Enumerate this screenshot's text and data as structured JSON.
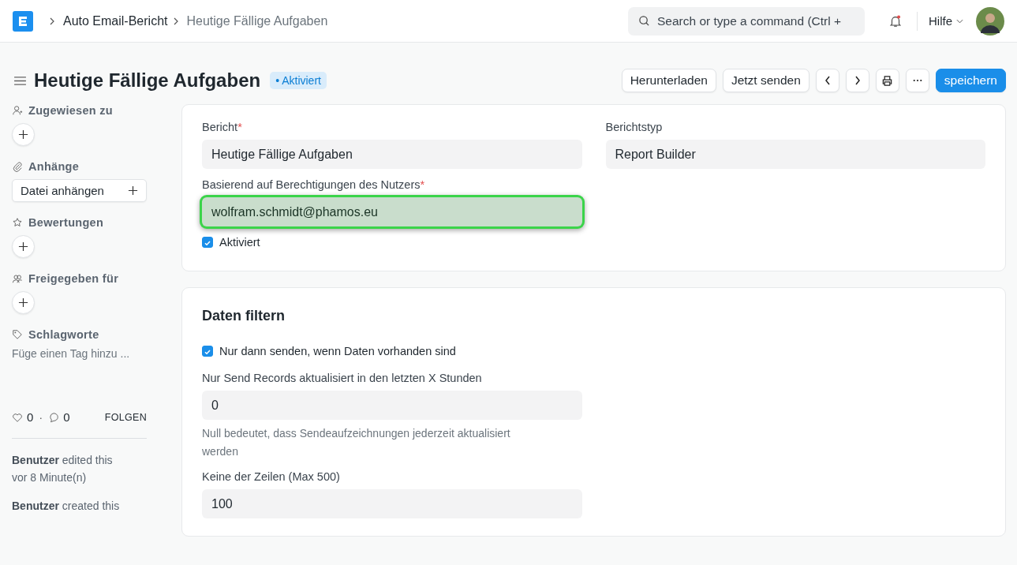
{
  "navbar": {
    "breadcrumbs": [
      {
        "label": "Auto Email-Bericht",
        "current": false
      },
      {
        "label": "Heutige Fällige Aufgaben",
        "current": true
      }
    ],
    "search": {
      "placeholder": "Search or type a command (Ctrl +"
    },
    "notifications": {
      "unread": true
    },
    "help_menu": "Hilfe"
  },
  "page_header": {
    "title": "Heutige Fällige Aufgaben",
    "status": "• Aktiviert",
    "buttons": [
      {
        "kind": "text",
        "label": "Herunterladen"
      },
      {
        "kind": "text",
        "label": "Jetzt senden"
      },
      {
        "kind": "prev"
      },
      {
        "kind": "next"
      },
      {
        "kind": "print"
      },
      {
        "kind": "more"
      },
      {
        "kind": "primary",
        "label": "speichern"
      }
    ]
  },
  "sidebar": {
    "sections": [
      {
        "kind": "add",
        "label": "Zugewiesen zu"
      },
      {
        "kind": "attach",
        "label": "Anhänge",
        "button": "Datei anhängen"
      },
      {
        "kind": "add",
        "label": "Bewertungen"
      },
      {
        "kind": "add",
        "label": "Freigegeben für"
      },
      {
        "kind": "tags",
        "label": "Schlagworte",
        "placeholder": "Füge einen Tag hinzu ..."
      }
    ],
    "likes": "0",
    "separator": "·",
    "comments": "0",
    "follow": "FOLGEN",
    "activity": [
      {
        "user": "Benutzer",
        "action": "edited this",
        "time": "vor 8 Minute(n)"
      },
      {
        "user": "Benutzer",
        "action": "created this"
      }
    ]
  },
  "form": {
    "fields_left": [
      {
        "kind": "input",
        "label": "Bericht",
        "required_mark": "*",
        "value": "Heutige Fällige Aufgaben",
        "highlighted": false
      },
      {
        "kind": "input",
        "label": "Basierend auf Berechtigungen des Nutzers",
        "required_mark": "*",
        "value": "wolfram.schmidt@phamos.eu",
        "highlighted": true
      },
      {
        "kind": "checkbox",
        "label": "Aktiviert",
        "checked": true
      }
    ],
    "fields_right": [
      {
        "kind": "input",
        "label": "Berichtstyp",
        "value": "Report Builder",
        "highlighted": false
      }
    ]
  },
  "filter_section": {
    "title": "Daten filtern",
    "fields": [
      {
        "kind": "checkbox",
        "label": "Nur dann senden, wenn Daten vorhanden sind",
        "checked": true
      },
      {
        "kind": "input",
        "label": "Nur Send Records aktualisiert in den letzten X Stunden",
        "value": "0",
        "highlighted": false,
        "description": "Null bedeutet, dass Sendeaufzeichnungen jederzeit aktualisiert werden"
      },
      {
        "kind": "input",
        "label": "Keine der Zeilen (Max 500)",
        "value": "100",
        "highlighted": false
      }
    ]
  }
}
